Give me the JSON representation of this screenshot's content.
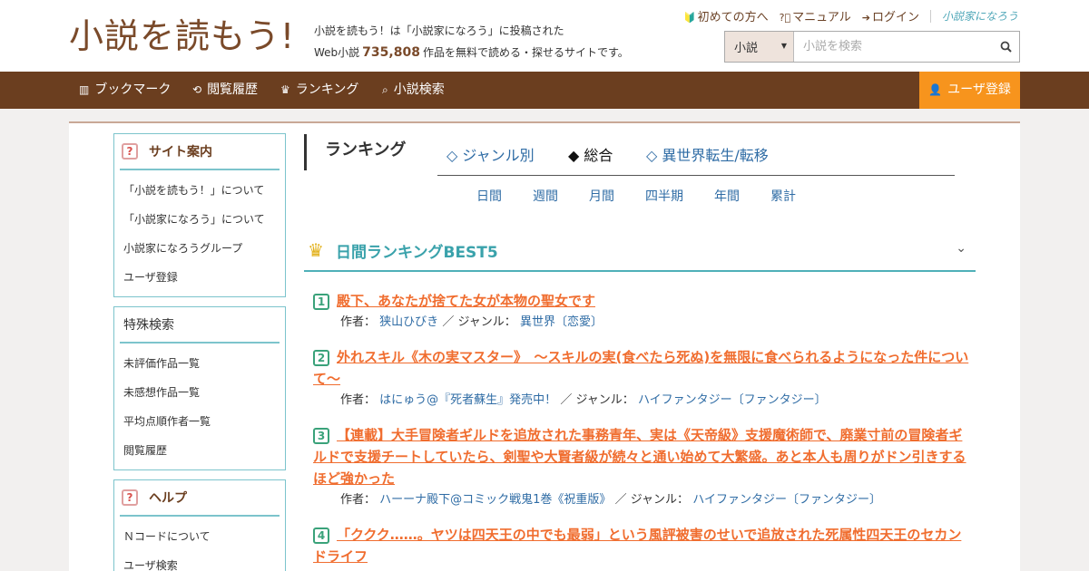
{
  "header": {
    "logo": "小説を読もう!",
    "tagline_1": "小説を読もう！は「小説家になろう」に投稿された",
    "tagline_2a": "Web小説",
    "count": "735,808",
    "tagline_2b": "作品を無料で読める・探せるサイトです。",
    "links": {
      "beginner": "初めての方へ",
      "manual": "マニュアル",
      "login": "ログイン",
      "narou_logo": "小説家になろう"
    },
    "search": {
      "select_value": "小説",
      "placeholder": "小説を検索"
    }
  },
  "nav": {
    "bookmark": "ブックマーク",
    "history": "閲覧履歴",
    "ranking": "ランキング",
    "search": "小説検索",
    "register": "ユーザ登録"
  },
  "sidebar": {
    "site_guide": {
      "title": "サイト案内",
      "items": [
        "「小説を読もう！」について",
        "「小説家になろう」について",
        "小説家になろうグループ",
        "ユーザ登録"
      ]
    },
    "special_search": {
      "title": "特殊検索",
      "items": [
        "未評価作品一覧",
        "未感想作品一覧",
        "平均点順作者一覧",
        "閲覧履歴"
      ]
    },
    "help": {
      "title": "ヘルプ",
      "items": [
        "Ｎコードについて",
        "ユーザ検索"
      ]
    }
  },
  "ranking": {
    "heading": "ランキング",
    "tabs": [
      "◇ ジャンル別",
      "◆ 総合",
      "◇ 異世界転生/転移"
    ],
    "periods": [
      "日間",
      "週間",
      "月間",
      "四半期",
      "年間",
      "累計"
    ],
    "best_title": "日間ランキングBEST5",
    "author_label": "作者：",
    "genre_label": "／ ジャンル：",
    "entries": [
      {
        "rank": "1",
        "title": "殿下、あなたが捨てた女が本物の聖女です",
        "author": "狭山ひびき",
        "genre": "異世界〔恋愛〕"
      },
      {
        "rank": "2",
        "title": "外れスキル《木の実マスター》　～スキルの実(食べたら死ぬ)を無限に食べられるようになった件について～",
        "author": "はにゅう@『死者蘇生』発売中！",
        "genre": "ハイファンタジー〔ファンタジー〕"
      },
      {
        "rank": "3",
        "title": "【連載】大手冒険者ギルドを追放された事務青年、実は《天帝級》支援魔術師で、廃業寸前の冒険者ギルドで支援チートしていたら、剣聖や大賢者級が続々と通い始めて大繁盛。あと本人も周りがドン引きするほど強かった",
        "author": "ハーーナ殿下@コミック戦鬼1巻《祝重版》",
        "genre": "ハイファンタジー〔ファンタジー〕"
      },
      {
        "rank": "4",
        "title": "「ククク……。ヤツは四天王の中でも最弱」という風評被害のせいで追放された死属性四天王のセカンドライフ",
        "author": "",
        "genre": ""
      }
    ]
  },
  "colors": {
    "brand_brown": "#6b3e1f",
    "accent_orange": "#f7941d",
    "teal": "#4fb0b8",
    "title_orange": "#f06d2f",
    "link_blue": "#2f6ca5"
  }
}
